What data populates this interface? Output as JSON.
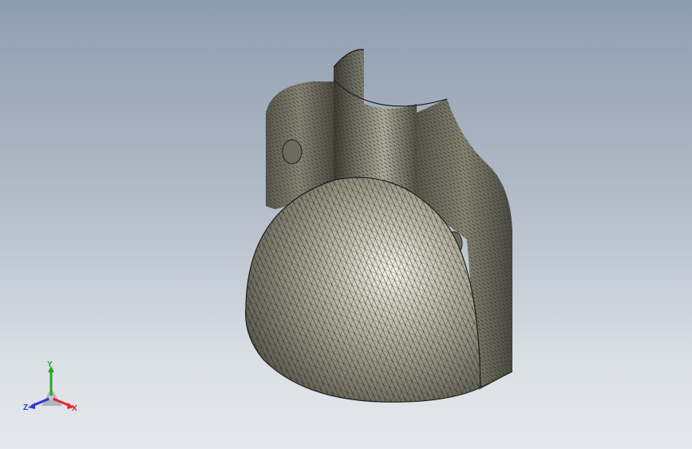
{
  "triad": {
    "x_label": "X",
    "y_label": "Y",
    "z_label": "Z",
    "x_color": "#e02a2a",
    "y_color": "#2aa52a",
    "z_color": "#2a3ad0"
  },
  "colors": {
    "background_top": "#8e9db0",
    "background_bottom": "#e6e9ed",
    "model_shade": "#7e7c6a",
    "mesh_line": "#1e1e1a"
  },
  "icons": {
    "view_triad": "xyz-axis-triad-icon"
  }
}
